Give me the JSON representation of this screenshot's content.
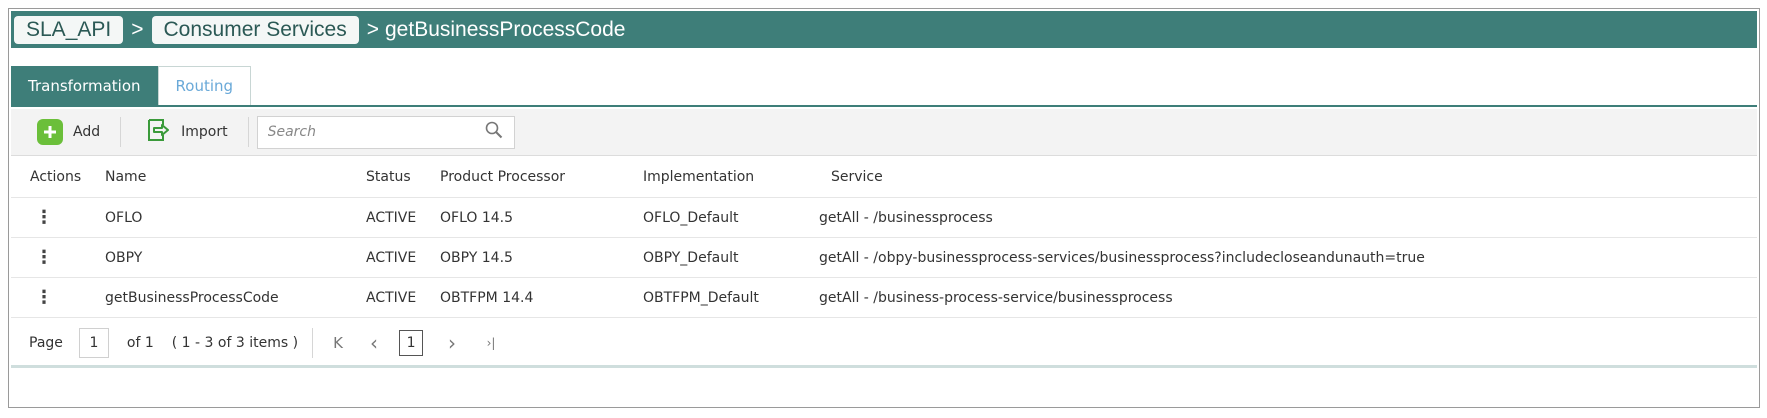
{
  "breadcrumb": {
    "root": "SLA_API",
    "parent": "Consumer Services",
    "separator": ">",
    "current": "getBusinessProcessCode"
  },
  "tabs": [
    {
      "label": "Transformation",
      "active": true
    },
    {
      "label": "Routing",
      "active": false
    }
  ],
  "toolbar": {
    "add_label": "Add",
    "import_label": "Import",
    "search_placeholder": "Search"
  },
  "table": {
    "columns": [
      "Actions",
      "Name",
      "Status",
      "Product Processor",
      "Implementation",
      "Service"
    ],
    "rows": [
      {
        "actions": "⋮",
        "name": "OFLO",
        "status": "ACTIVE",
        "processor": "OFLO 14.5",
        "implementation": "OFLO_Default",
        "service": "getAll - /businessprocess"
      },
      {
        "actions": "⋮",
        "name": "OBPY",
        "status": "ACTIVE",
        "processor": "OBPY 14.5",
        "implementation": "OBPY_Default",
        "service": "getAll - /obpy-businessprocess-services/businessprocess?includecloseandunauth=true"
      },
      {
        "actions": "⋮",
        "name": "getBusinessProcessCode",
        "status": "ACTIVE",
        "processor": "OBTFPM 14.4",
        "implementation": "OBTFPM_Default",
        "service": "getAll - /business-process-service/businessprocess"
      }
    ]
  },
  "pager": {
    "page_label": "Page",
    "page_value": "1",
    "of_label": "of 1",
    "items_label": "( 1 - 3 of 3 items )",
    "current_page": "1",
    "first_icon": "K",
    "prev_icon": "‹",
    "next_icon": "›",
    "last_icon": "›|"
  },
  "colors": {
    "header_teal": "#3e7e79",
    "add_green": "#6bbf3a",
    "inactive_tab": "#6aa9d8"
  },
  "icons": {
    "add": "plus-square-icon",
    "import": "import-icon",
    "search": "magnifier-icon"
  }
}
